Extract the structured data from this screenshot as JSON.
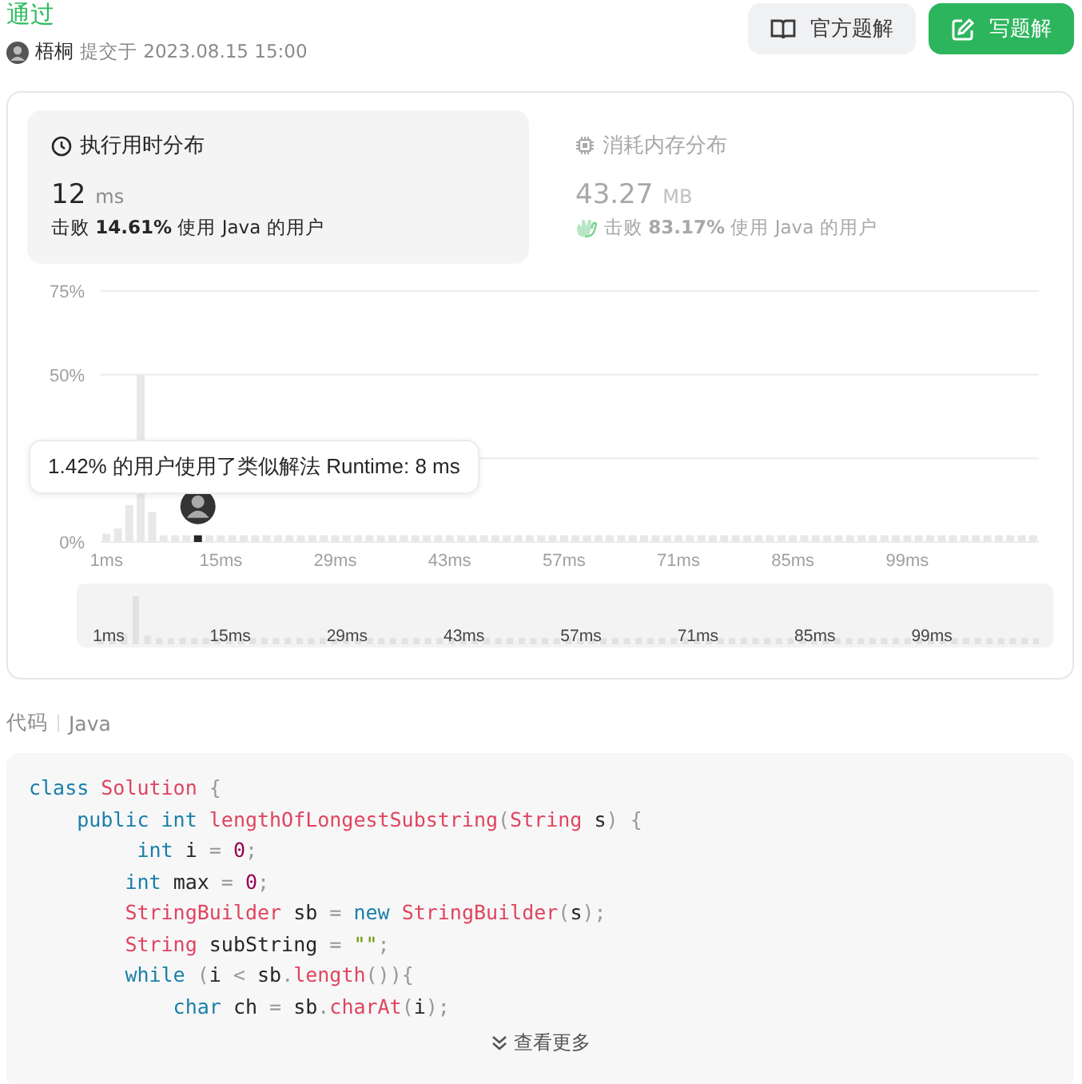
{
  "status": "通过",
  "author": {
    "name": "梧桐",
    "submitted": "提交于 2023.08.15 15:00"
  },
  "buttons": [
    {
      "label": "官方题解",
      "kind": "book",
      "primary": false
    },
    {
      "label": "写题解",
      "kind": "edit",
      "primary": true
    }
  ],
  "stats": [
    {
      "kind": "time",
      "title": "执行用时分布",
      "value": "12",
      "unit": "ms",
      "beat": "击败 **14.61%** 使用 Java 的用户",
      "selected": true,
      "badge": false
    },
    {
      "kind": "memory",
      "title": "消耗内存分布",
      "value": "43.27",
      "unit": "MB",
      "beat": "击败 **83.17%** 使用 Java 的用户",
      "selected": false,
      "badge": true
    }
  ],
  "chart_data": {
    "type": "bar",
    "ylim": [
      0,
      75
    ],
    "yticks": [
      {
        "value": 0,
        "label": "0%"
      },
      {
        "value": 50,
        "label": "50%"
      },
      {
        "value": 75,
        "label": "75%"
      }
    ],
    "categories": [
      "1ms",
      null,
      null,
      null,
      null,
      null,
      null,
      null,
      null,
      null,
      "15ms",
      null,
      null,
      null,
      null,
      null,
      null,
      null,
      null,
      null,
      "29ms",
      null,
      null,
      null,
      null,
      null,
      null,
      null,
      null,
      null,
      "43ms",
      null,
      null,
      null,
      null,
      null,
      null,
      null,
      null,
      null,
      "57ms",
      null,
      null,
      null,
      null,
      null,
      null,
      null,
      null,
      null,
      "71ms",
      null,
      null,
      null,
      null,
      null,
      null,
      null,
      null,
      null,
      "85ms",
      null,
      null,
      null,
      null,
      null,
      null,
      null,
      null,
      null,
      "99ms",
      null,
      null,
      null,
      null,
      null,
      null,
      null,
      null,
      null,
      null,
      null
    ],
    "series": [
      {
        "color": "#e8e8e8",
        "values": [
          2.5,
          4,
          11,
          50,
          9,
          2,
          2,
          2,
          null,
          2,
          2,
          2,
          2,
          2,
          2,
          2,
          2,
          2,
          2,
          2,
          2,
          2,
          2,
          2,
          2,
          2,
          2,
          2,
          2,
          2,
          2,
          2,
          2,
          2,
          2,
          2,
          2,
          2,
          2,
          2,
          2,
          2,
          2,
          2,
          2,
          2,
          2,
          2,
          2,
          2,
          2,
          2,
          2,
          2,
          2,
          2,
          2,
          2,
          2,
          2,
          2,
          2,
          2,
          2,
          2,
          2,
          2,
          2,
          2,
          2,
          2,
          2,
          2,
          2,
          2,
          2,
          2,
          2,
          2,
          2,
          2,
          2
        ]
      },
      {
        "color": "#262626",
        "values": [
          null,
          null,
          null,
          null,
          null,
          null,
          null,
          null,
          2,
          null,
          null,
          null,
          null,
          null,
          null,
          null,
          null,
          null,
          null,
          null,
          null,
          null,
          null,
          null,
          null,
          null,
          null,
          null,
          null,
          null,
          null,
          null,
          null,
          null,
          null,
          null,
          null,
          null,
          null,
          null,
          null,
          null,
          null,
          null,
          null,
          null,
          null,
          null,
          null,
          null,
          null,
          null,
          null,
          null,
          null,
          null,
          null,
          null,
          null,
          null,
          null,
          null,
          null,
          null,
          null,
          null,
          null,
          null,
          null,
          null,
          null,
          null,
          null,
          null,
          null,
          null,
          null,
          null,
          null,
          null,
          null,
          null
        ]
      }
    ]
  },
  "tooltip": "1.42% 的用户使用了类似解法 Runtime: 8 ms",
  "overview_labels": [
    "1ms",
    "15ms",
    "29ms",
    "43ms",
    "57ms",
    "71ms",
    "85ms",
    "99ms"
  ],
  "code": {
    "label": "代码",
    "language": "Java",
    "more": "查看更多",
    "lines": [
      [
        {
          "text": "class ",
          "kind": "keyword"
        },
        {
          "text": "Solution ",
          "kind": "type"
        },
        {
          "text": "{",
          "kind": "punct"
        }
      ],
      [
        {
          "text": "    public int ",
          "kind": "keyword"
        },
        {
          "text": "lengthOfLongestSubstring",
          "kind": "type"
        },
        {
          "text": "(",
          "kind": "punct"
        },
        {
          "text": "String ",
          "kind": "type"
        },
        {
          "text": "s",
          "kind": "plain"
        },
        {
          "text": ") {",
          "kind": "punct"
        }
      ],
      [
        {
          "text": "         int ",
          "kind": "keyword"
        },
        {
          "text": "i ",
          "kind": "plain"
        },
        {
          "text": "= ",
          "kind": "punct"
        },
        {
          "text": "0",
          "kind": "number"
        },
        {
          "text": ";",
          "kind": "punct"
        }
      ],
      [
        {
          "text": "        int ",
          "kind": "keyword"
        },
        {
          "text": "max ",
          "kind": "plain"
        },
        {
          "text": "= ",
          "kind": "punct"
        },
        {
          "text": "0",
          "kind": "number"
        },
        {
          "text": ";",
          "kind": "punct"
        }
      ],
      [
        {
          "text": "        StringBuilder ",
          "kind": "type"
        },
        {
          "text": "sb ",
          "kind": "plain"
        },
        {
          "text": "= ",
          "kind": "punct"
        },
        {
          "text": "new ",
          "kind": "keyword"
        },
        {
          "text": "StringBuilder",
          "kind": "type"
        },
        {
          "text": "(",
          "kind": "punct"
        },
        {
          "text": "s",
          "kind": "plain"
        },
        {
          "text": ");",
          "kind": "punct"
        }
      ],
      [
        {
          "text": "        String ",
          "kind": "type"
        },
        {
          "text": "subString ",
          "kind": "plain"
        },
        {
          "text": "= ",
          "kind": "punct"
        },
        {
          "text": "\"\"",
          "kind": "string"
        },
        {
          "text": ";",
          "kind": "punct"
        }
      ],
      [
        {
          "text": "        while ",
          "kind": "keyword"
        },
        {
          "text": "(",
          "kind": "punct"
        },
        {
          "text": "i ",
          "kind": "plain"
        },
        {
          "text": "< ",
          "kind": "punct"
        },
        {
          "text": "sb",
          "kind": "plain"
        },
        {
          "text": ".",
          "kind": "punct"
        },
        {
          "text": "length",
          "kind": "type"
        },
        {
          "text": "()){",
          "kind": "punct"
        }
      ],
      [
        {
          "text": "            char ",
          "kind": "keyword"
        },
        {
          "text": "ch ",
          "kind": "plain"
        },
        {
          "text": "= ",
          "kind": "punct"
        },
        {
          "text": "sb",
          "kind": "plain"
        },
        {
          "text": ".",
          "kind": "punct"
        },
        {
          "text": "charAt",
          "kind": "type"
        },
        {
          "text": "(",
          "kind": "punct"
        },
        {
          "text": "i",
          "kind": "plain"
        },
        {
          "text": ");",
          "kind": "punct"
        }
      ]
    ]
  }
}
